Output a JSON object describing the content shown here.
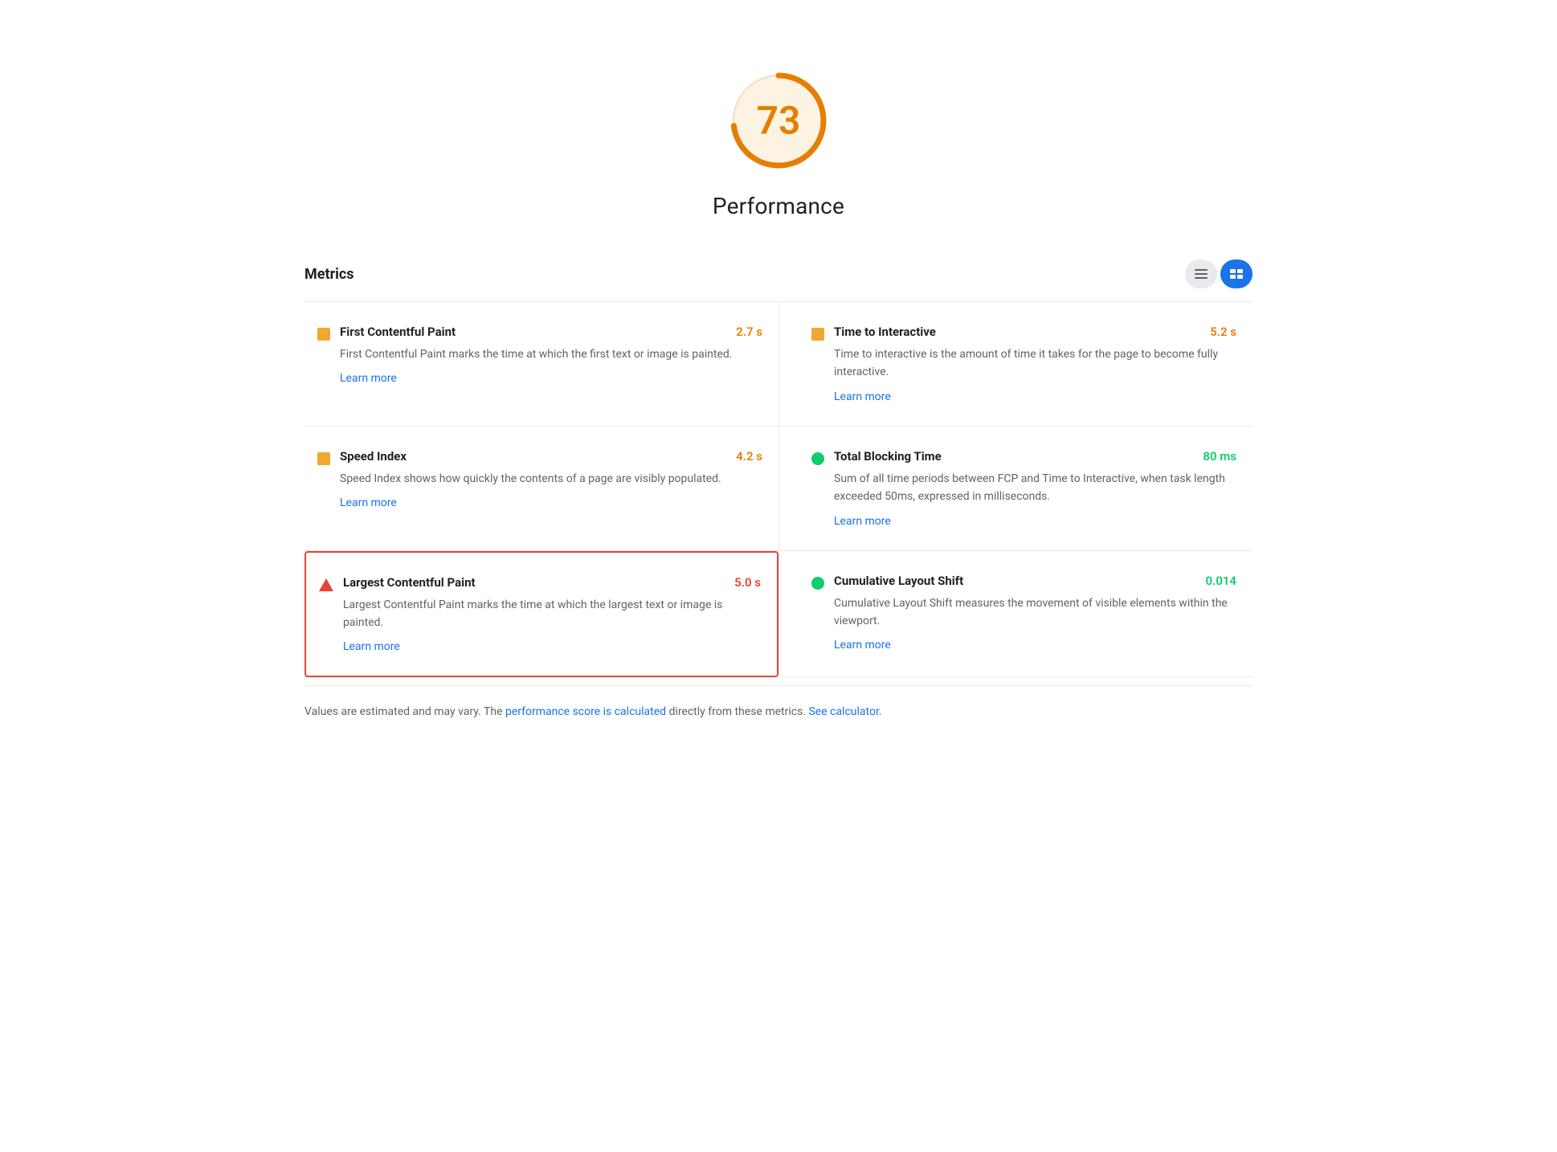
{
  "score": {
    "value": "73",
    "label": "Performance",
    "color": "#e67e00",
    "bg_color": "#fdf3e3"
  },
  "metrics_header": {
    "title": "Metrics",
    "toggle_list_label": "≡",
    "toggle_detail_label": "☰"
  },
  "metrics": [
    {
      "id": "fcp",
      "name": "First Contentful Paint",
      "description": "First Contentful Paint marks the time at which the first text or image is painted.",
      "value": "2.7 s",
      "value_color": "orange",
      "icon": "square-orange",
      "learn_more_text": "Learn more",
      "learn_more_url": "#",
      "col": "left",
      "highlighted": false
    },
    {
      "id": "tti",
      "name": "Time to Interactive",
      "description": "Time to interactive is the amount of time it takes for the page to become fully interactive.",
      "value": "5.2 s",
      "value_color": "orange",
      "icon": "square-orange",
      "learn_more_text": "Learn more",
      "learn_more_url": "#",
      "col": "right",
      "highlighted": false
    },
    {
      "id": "si",
      "name": "Speed Index",
      "description": "Speed Index shows how quickly the contents of a page are visibly populated.",
      "value": "4.2 s",
      "value_color": "orange",
      "icon": "square-orange",
      "learn_more_text": "Learn more",
      "learn_more_url": "#",
      "col": "left",
      "highlighted": false
    },
    {
      "id": "tbt",
      "name": "Total Blocking Time",
      "description": "Sum of all time periods between FCP and Time to Interactive, when task length exceeded 50ms, expressed in milliseconds.",
      "value": "80 ms",
      "value_color": "green",
      "icon": "circle-green",
      "learn_more_text": "Learn more",
      "learn_more_url": "#",
      "col": "right",
      "highlighted": false
    },
    {
      "id": "lcp",
      "name": "Largest Contentful Paint",
      "description": "Largest Contentful Paint marks the time at which the largest text or image is painted.",
      "value": "5.0 s",
      "value_color": "red",
      "icon": "triangle-red",
      "learn_more_text": "Learn more",
      "learn_more_url": "#",
      "col": "left",
      "highlighted": true
    },
    {
      "id": "cls",
      "name": "Cumulative Layout Shift",
      "description": "Cumulative Layout Shift measures the movement of visible elements within the viewport.",
      "value": "0.014",
      "value_color": "green",
      "icon": "circle-green",
      "learn_more_text": "Learn more",
      "learn_more_url": "#",
      "col": "right",
      "highlighted": false
    }
  ],
  "footer": {
    "text_before": "Values are estimated and may vary. The ",
    "link1_text": "performance score is calculated",
    "link1_url": "#",
    "text_middle": " directly from these metrics. ",
    "link2_text": "See calculator.",
    "link2_url": "#"
  }
}
